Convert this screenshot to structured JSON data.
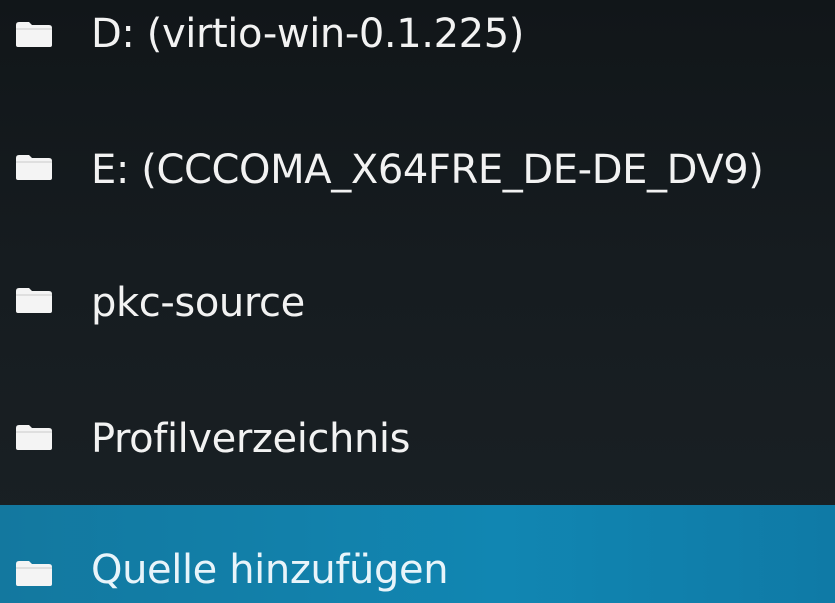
{
  "file_browser": {
    "items": [
      {
        "label": "D: (virtio-win-0.1.225)",
        "icon": "folder-icon",
        "selected": false
      },
      {
        "label": "E: (CCCOMA_X64FRE_DE-DE_DV9)",
        "icon": "folder-icon",
        "selected": false
      },
      {
        "label": "pkc-source",
        "icon": "folder-icon",
        "selected": false
      },
      {
        "label": "Profilverzeichnis",
        "icon": "folder-icon",
        "selected": false
      },
      {
        "label": "Quelle hinzufügen",
        "icon": "folder-icon",
        "selected": true
      }
    ]
  },
  "colors": {
    "background": "#161c20",
    "selected_highlight": "#1186b2",
    "text": "#f2f2f2"
  }
}
